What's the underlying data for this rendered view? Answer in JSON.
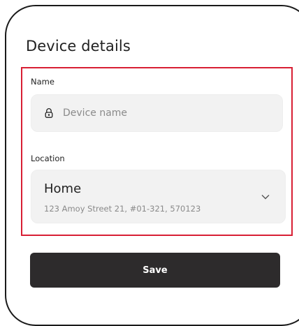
{
  "page": {
    "title": "Device details"
  },
  "form": {
    "name_label": "Name",
    "name_placeholder": "Device name",
    "name_icon": "lock-icon",
    "location_label": "Location",
    "location_value": "Home",
    "location_address": "123 Amoy Street 21, #01-321, 570123",
    "location_icon": "chevron-down-icon"
  },
  "actions": {
    "save_label": "Save"
  },
  "colors": {
    "highlight_border": "#d81f34",
    "button_bg": "#2d2b2c",
    "field_bg": "#f2f2f2"
  }
}
